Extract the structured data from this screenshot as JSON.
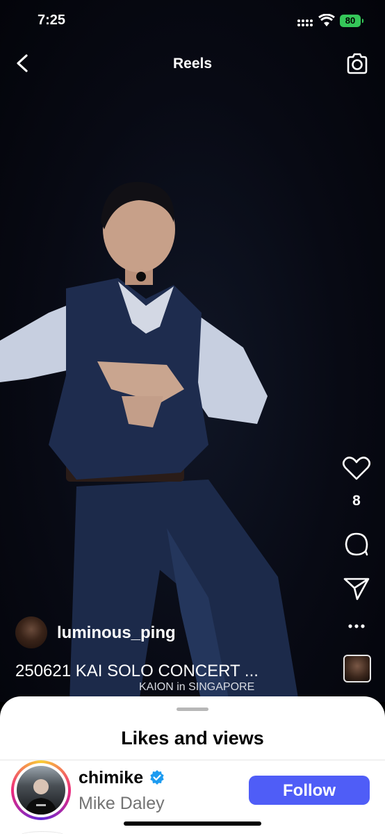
{
  "status_bar": {
    "time": "7:25",
    "battery": "80"
  },
  "header": {
    "title": "Reels"
  },
  "actions": {
    "like_count": "8"
  },
  "post": {
    "username": "luminous_ping",
    "caption": "250621 KAI SOLO CONCERT ...",
    "video_overlay_text": "KAION in SINGAPORE"
  },
  "sheet": {
    "title": "Likes and views",
    "users": [
      {
        "username": "chimike",
        "full_name": "Mike Daley",
        "verified": true,
        "follow_label": "Follow"
      }
    ]
  },
  "colors": {
    "follow_button": "#4f5df7",
    "verified_badge": "#1d9bf0",
    "battery": "#35c759"
  }
}
